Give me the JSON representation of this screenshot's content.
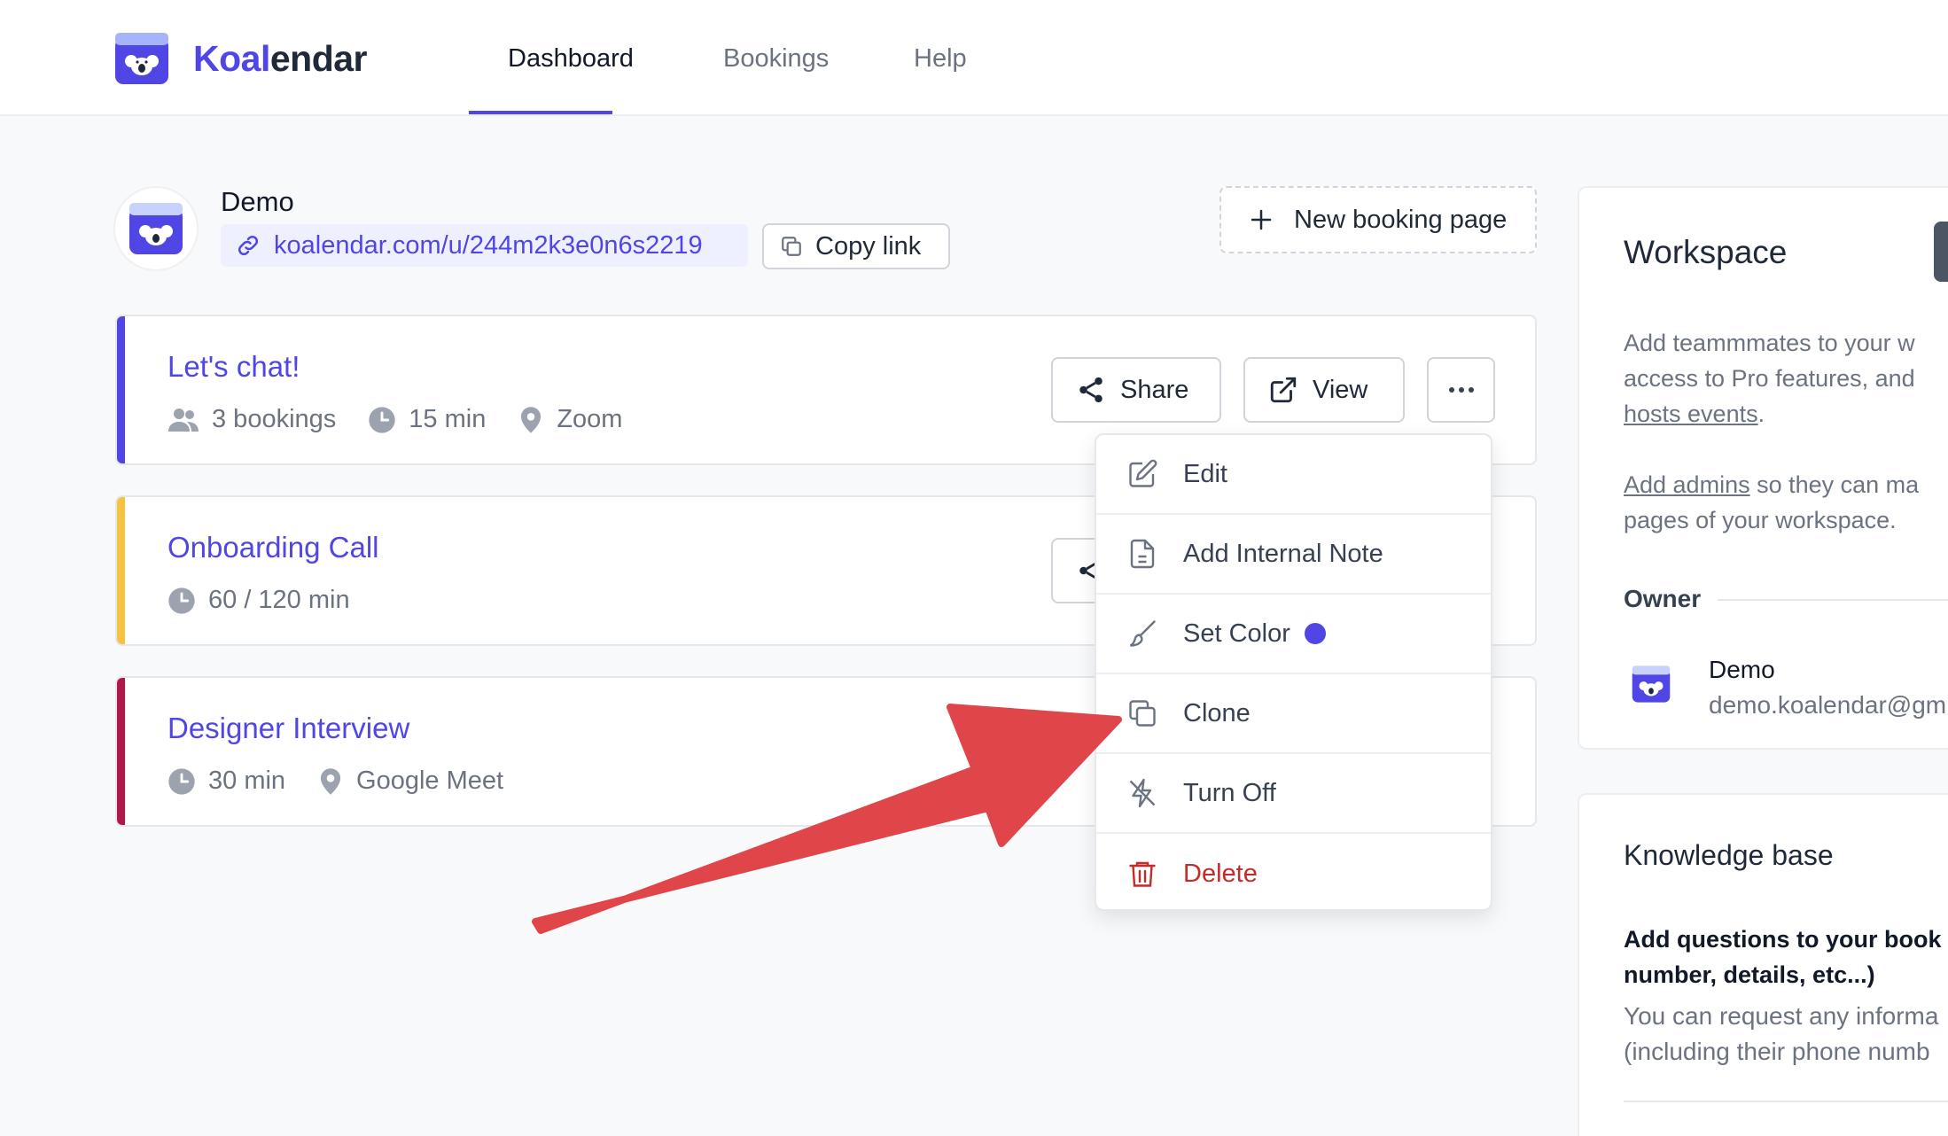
{
  "app": {
    "brand_part1": "Koal",
    "brand_part2": "endar",
    "brand_color": "#4f46e5"
  },
  "nav": {
    "tabs": [
      {
        "label": "Dashboard",
        "active": true
      },
      {
        "label": "Bookings",
        "active": false
      },
      {
        "label": "Help",
        "active": false
      }
    ]
  },
  "profile": {
    "name": "Demo",
    "link": "koalendar.com/u/244m2k3e0n6s2219",
    "copy_label": "Copy link",
    "new_booking_label": "New booking page"
  },
  "booking_pages": [
    {
      "title": "Let's chat!",
      "accent": "#4f46e5",
      "meta": {
        "bookings": "3 bookings",
        "duration": "15 min",
        "location": "Zoom"
      },
      "actions": {
        "share": "Share",
        "view": "View"
      }
    },
    {
      "title": "Onboarding Call",
      "accent": "#f5c242",
      "meta": {
        "duration": "60 / 120 min"
      }
    },
    {
      "title": "Designer Interview",
      "accent": "#b0184a",
      "meta": {
        "duration": "30 min",
        "location": "Google Meet"
      }
    }
  ],
  "menu": {
    "items": [
      {
        "label": "Edit",
        "icon": "pencil-icon"
      },
      {
        "label": "Add Internal Note",
        "icon": "document-icon"
      },
      {
        "label": "Set Color",
        "icon": "paintbrush-icon",
        "color": "#4f46e5"
      },
      {
        "label": "Clone",
        "icon": "copy-icon"
      },
      {
        "label": "Turn Off",
        "icon": "power-off-icon"
      },
      {
        "label": "Delete",
        "icon": "trash-icon",
        "color": "#c42b2b"
      }
    ]
  },
  "annotation": {
    "arrow_color": "#e0454a"
  },
  "workspace": {
    "title": "Workspace",
    "text1_line1": "Add teammmates to your w",
    "text1_line2": "access to Pro features, and",
    "text1_link": "hosts events",
    "text1_after": ".",
    "text2_link": "Add admins",
    "text2_line1_rest": " so they can ma",
    "text2_line2": "pages of your workspace.",
    "owner_label": "Owner",
    "owner_name": "Demo",
    "owner_email": "demo.koalendar@gm"
  },
  "knowledge_base": {
    "title": "Knowledge base",
    "question_line1": "Add questions to your book",
    "question_line2": "number, details, etc...)",
    "answer_line1": "You can request any informa",
    "answer_line2": "(including their phone numb"
  }
}
